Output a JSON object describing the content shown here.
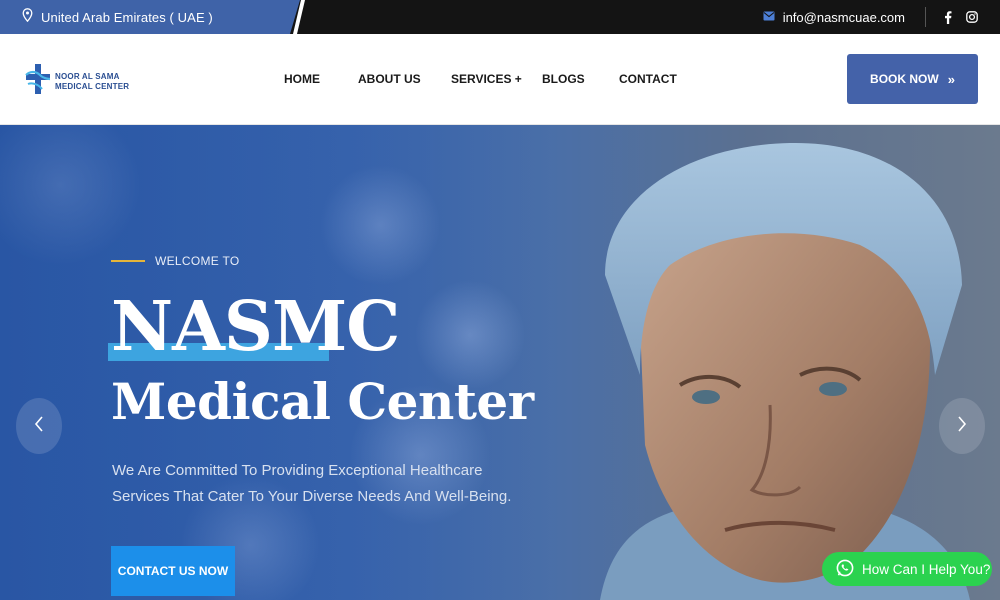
{
  "topbar": {
    "location": "United Arab Emirates ( UAE )",
    "email": "info@nasmcuae.com",
    "social": [
      "facebook-icon",
      "instagram-icon"
    ]
  },
  "header": {
    "logo_line1": "NOOR AL SAMA",
    "logo_line2": "MEDICAL CENTER",
    "nav": [
      "HOME",
      "ABOUT US",
      "SERVICES +",
      "BLOGS",
      "CONTACT"
    ],
    "book_now": "BOOK NOW",
    "book_icon": "double-chevron-right-icon"
  },
  "hero": {
    "welcome": "WELCOME TO",
    "title1": "NASMC",
    "title2": "Medical Center",
    "subtitle": "We Are Committed To Providing Exceptional Healthcare Services That Cater To Your Diverse Needs And Well-Being.",
    "cta": "CONTACT US NOW",
    "prev_icon": "chevron-left-icon",
    "next_icon": "chevron-right-icon"
  },
  "whatsapp": {
    "label": "How Can I Help You?",
    "icon": "whatsapp-icon"
  },
  "colors": {
    "brand_blue": "#4462a9",
    "cta_blue": "#1c8fea",
    "accent_gold": "#e5b53a",
    "whatsapp_green": "#2bd24f"
  }
}
